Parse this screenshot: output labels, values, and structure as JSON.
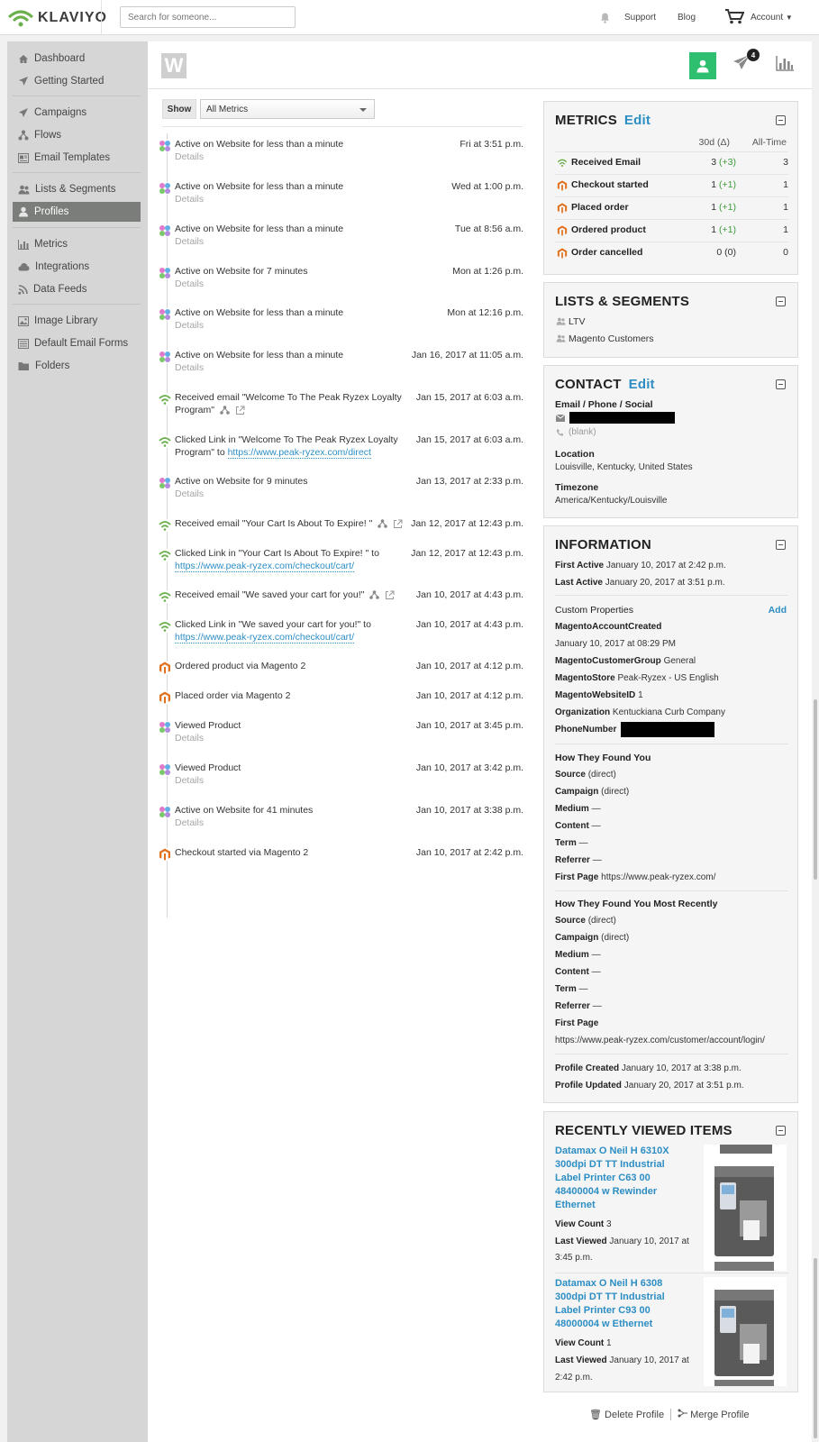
{
  "topbar": {
    "brand": "KLAVIYO",
    "search_placeholder": "Search for someone...",
    "support": "Support",
    "blog": "Blog",
    "account": "Account"
  },
  "sidebar": {
    "items": [
      {
        "label": "Dashboard",
        "icon": "dashboard-icon"
      },
      {
        "label": "Getting Started",
        "icon": "rocket-icon"
      },
      {
        "label": "Campaigns",
        "icon": "send-icon"
      },
      {
        "label": "Flows",
        "icon": "flow-icon"
      },
      {
        "label": "Email Templates",
        "icon": "template-icon"
      },
      {
        "label": "Lists & Segments",
        "icon": "users-icon"
      },
      {
        "label": "Profiles",
        "icon": "user-icon"
      },
      {
        "label": "Metrics",
        "icon": "bar-chart-icon"
      },
      {
        "label": "Integrations",
        "icon": "cloud-icon"
      },
      {
        "label": "Data Feeds",
        "icon": "rss-icon"
      },
      {
        "label": "Image Library",
        "icon": "image-icon"
      },
      {
        "label": "Default Email Forms",
        "icon": "form-icon"
      },
      {
        "label": "Folders",
        "icon": "folder-icon"
      }
    ]
  },
  "profile": {
    "initial": "W",
    "send_badge": "4"
  },
  "filter": {
    "show": "Show",
    "selected": "All Metrics"
  },
  "timeline": [
    {
      "title": "Active on Website for less than a minute",
      "time": "Fri at 3:51 p.m.",
      "details": "Details",
      "type": "web"
    },
    {
      "title": "Active on Website for less than a minute",
      "time": "Wed at 1:00 p.m.",
      "details": "Details",
      "type": "web"
    },
    {
      "title": "Active on Website for less than a minute",
      "time": "Tue at 8:56 a.m.",
      "details": "Details",
      "type": "web"
    },
    {
      "title": "Active on Website for 7 minutes",
      "time": "Mon at 1:26 p.m.",
      "details": "Details",
      "type": "web"
    },
    {
      "title": "Active on Website for less than a minute",
      "time": "Mon at 12:16 p.m.",
      "details": "Details",
      "type": "web"
    },
    {
      "title": "Active on Website for less than a minute",
      "time": "Jan 16, 2017 at 11:05 a.m.",
      "details": "Details",
      "type": "web"
    },
    {
      "title": "Received email \"Welcome To The Peak Ryzex Loyalty Program\"",
      "time": "Jan 15, 2017 at 6:03 a.m.",
      "type": "email"
    },
    {
      "title": "Clicked Link in \"Welcome To The Peak Ryzex Loyalty Program\" to",
      "link": "https://www.peak-ryzex.com/direct",
      "time": "Jan 15, 2017 at 6:03 a.m.",
      "type": "email"
    },
    {
      "title": "Active on Website for 9 minutes",
      "time": "Jan 13, 2017 at 2:33 p.m.",
      "details": "Details",
      "type": "web"
    },
    {
      "title": "Received email \"Your Cart Is About To Expire! \"",
      "time": "Jan 12, 2017 at 12:43 p.m.",
      "type": "email"
    },
    {
      "title": "Clicked Link in \"Your Cart Is About To Expire! \" to",
      "link": "https://www.peak-ryzex.com/checkout/cart/",
      "time": "Jan 12, 2017 at 12:43 p.m.",
      "type": "email"
    },
    {
      "title": "Received email \"We saved your cart for you!\"",
      "time": "Jan 10, 2017 at 4:43 p.m.",
      "type": "email"
    },
    {
      "title": "Clicked Link in \"We saved your cart for you!\" to",
      "link": "https://www.peak-ryzex.com/checkout/cart/",
      "time": "Jan 10, 2017 at 4:43 p.m.",
      "type": "email"
    },
    {
      "title": "Ordered product via Magento 2",
      "time": "Jan 10, 2017 at 4:12 p.m.",
      "type": "magento"
    },
    {
      "title": "Placed order via Magento 2",
      "time": "Jan 10, 2017 at 4:12 p.m.",
      "type": "magento"
    },
    {
      "title": "Viewed Product",
      "time": "Jan 10, 2017 at 3:45 p.m.",
      "details": "Details",
      "type": "web"
    },
    {
      "title": "Viewed Product",
      "time": "Jan 10, 2017 at 3:42 p.m.",
      "details": "Details",
      "type": "web"
    },
    {
      "title": "Active on Website for 41 minutes",
      "time": "Jan 10, 2017 at 3:38 p.m.",
      "details": "Details",
      "type": "web"
    },
    {
      "title": "Checkout started via Magento 2",
      "time": "Jan 10, 2017 at 2:42 p.m.",
      "type": "magento"
    }
  ],
  "metrics": {
    "title": "METRICS",
    "edit": "Edit",
    "col_30d": "30d (Δ)",
    "col_all": "All-Time",
    "rows": [
      {
        "name": "Received Email",
        "v30": "3",
        "delta": "(+3)",
        "all": "3",
        "icon": "klaviyo"
      },
      {
        "name": "Checkout started",
        "v30": "1",
        "delta": "(+1)",
        "all": "1",
        "icon": "magento"
      },
      {
        "name": "Placed order",
        "v30": "1",
        "delta": "(+1)",
        "all": "1",
        "icon": "magento"
      },
      {
        "name": "Ordered product",
        "v30": "1",
        "delta": "(+1)",
        "all": "1",
        "icon": "magento"
      },
      {
        "name": "Order cancelled",
        "v30": "0",
        "delta": "(0)",
        "all": "0",
        "icon": "magento"
      }
    ]
  },
  "lists": {
    "title": "LISTS & SEGMENTS",
    "items": [
      "LTV",
      "Magento Customers"
    ]
  },
  "contact": {
    "title": "CONTACT",
    "edit": "Edit",
    "email_label": "Email / Phone / Social",
    "phone": "(blank)",
    "location_label": "Location",
    "location": "Louisville, Kentucky, United States",
    "timezone_label": "Timezone",
    "timezone": "America/Kentucky/Louisville"
  },
  "info": {
    "title": "INFORMATION",
    "first_active_label": "First Active",
    "first_active": "January 10, 2017 at 2:42 p.m.",
    "last_active_label": "Last Active",
    "last_active": "January 20, 2017 at 3:51 p.m.",
    "custom_label": "Custom Properties",
    "add": "Add",
    "mac_label": "MagentoAccountCreated",
    "mac": "January 10, 2017 at 08:29 PM",
    "mcg_label": "MagentoCustomerGroup",
    "mcg": "General",
    "ms_label": "MagentoStore",
    "ms": "Peak-Ryzex - US English",
    "mw_label": "MagentoWebsiteID",
    "mw": "1",
    "org_label": "Organization",
    "org": "Kentuckiana Curb Company",
    "phone_label": "PhoneNumber",
    "found_title": "How They Found You",
    "found": {
      "source": "(direct)",
      "campaign": "(direct)",
      "medium": "—",
      "content": "—",
      "term": "—",
      "referrer": "—",
      "first_page": "https://www.peak-ryzex.com/"
    },
    "recent_title": "How They Found You Most Recently",
    "recent": {
      "source": "(direct)",
      "campaign": "(direct)",
      "medium": "—",
      "content": "—",
      "term": "—",
      "referrer": "—",
      "first_page": "https://www.peak-ryzex.com/customer/account/login/"
    },
    "labels": {
      "source": "Source",
      "campaign": "Campaign",
      "medium": "Medium",
      "content": "Content",
      "term": "Term",
      "referrer": "Referrer",
      "first_page": "First Page"
    },
    "created_label": "Profile Created",
    "created": "January 10, 2017 at 3:38 p.m.",
    "updated_label": "Profile Updated",
    "updated": "January 20, 2017 at 3:51 p.m."
  },
  "recent_items": {
    "title": "RECENTLY VIEWED ITEMS",
    "view_count_label": "View Count",
    "last_viewed_label": "Last Viewed",
    "items": [
      {
        "name": "Datamax O Neil H 6310X 300dpi DT TT Industrial Label Printer C63 00 48400004 w Rewinder Ethernet",
        "view_count": "3",
        "last_viewed_1": "January 10, 2017 at",
        "last_viewed_2": "3:45 p.m."
      },
      {
        "name": "Datamax O Neil H 6308 300dpi DT TT Industrial Label Printer C93 00 48000004 w Ethernet",
        "view_count": "1",
        "last_viewed_1": "January 10, 2017 at",
        "last_viewed_2": "2:42 p.m."
      }
    ]
  },
  "footer": {
    "delete": "Delete Profile",
    "merge": "Merge Profile"
  },
  "colors": {
    "accent": "#2d8ec4",
    "green": "#2fbf71",
    "sidebar": "#d5d6d5",
    "active_nav": "#7b7d7a"
  }
}
